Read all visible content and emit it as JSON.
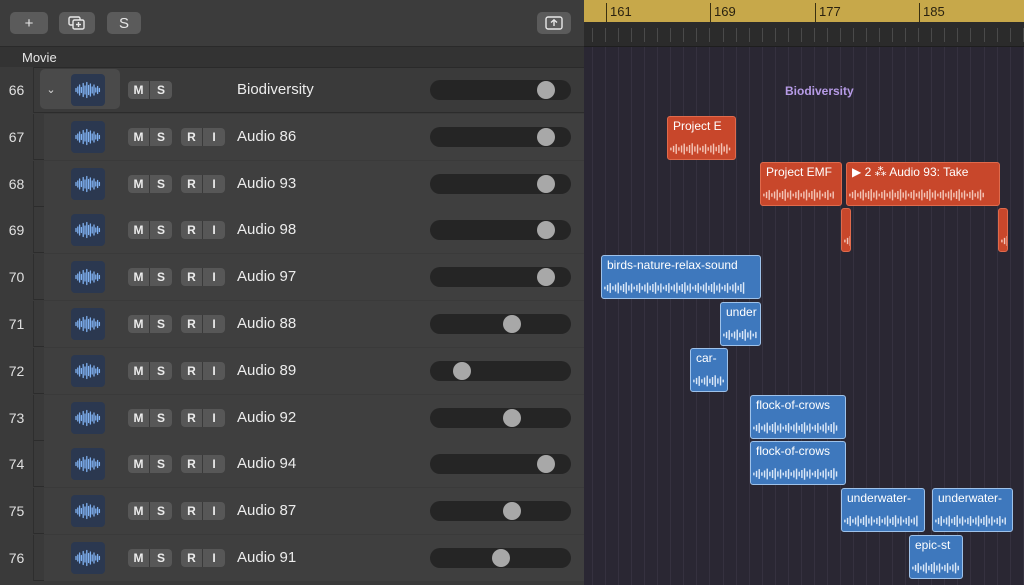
{
  "toolbar": {
    "add_label": "+",
    "duplicate_label": "⧉",
    "solo_label": "S",
    "upload_label": "⇪"
  },
  "group_label": "Movie",
  "tracks": [
    {
      "num": "66",
      "name": "Biodiversity",
      "folder": true,
      "ms": [
        "M",
        "S"
      ],
      "volume": 0.88
    },
    {
      "num": "67",
      "name": "Audio 86",
      "ms": [
        "M",
        "S",
        "R",
        "I"
      ],
      "volume": 0.88
    },
    {
      "num": "68",
      "name": "Audio 93",
      "ms": [
        "M",
        "S",
        "R",
        "I"
      ],
      "volume": 0.88
    },
    {
      "num": "69",
      "name": "Audio 98",
      "ms": [
        "M",
        "S",
        "R",
        "I"
      ],
      "volume": 0.88
    },
    {
      "num": "70",
      "name": "Audio 97",
      "ms": [
        "M",
        "S",
        "R",
        "I"
      ],
      "volume": 0.88
    },
    {
      "num": "71",
      "name": "Audio 88",
      "ms": [
        "M",
        "S",
        "R",
        "I"
      ],
      "volume": 0.6
    },
    {
      "num": "72",
      "name": "Audio 89",
      "ms": [
        "M",
        "S",
        "R",
        "I"
      ],
      "volume": 0.18
    },
    {
      "num": "73",
      "name": "Audio 92",
      "ms": [
        "M",
        "S",
        "R",
        "I"
      ],
      "volume": 0.6
    },
    {
      "num": "74",
      "name": "Audio 94",
      "ms": [
        "M",
        "S",
        "R",
        "I"
      ],
      "volume": 0.88
    },
    {
      "num": "75",
      "name": "Audio 87",
      "ms": [
        "M",
        "S",
        "R",
        "I"
      ],
      "volume": 0.6
    },
    {
      "num": "76",
      "name": "Audio 91",
      "ms": [
        "M",
        "S",
        "R",
        "I"
      ],
      "volume": 0.5
    }
  ],
  "ruler": {
    "bars": [
      "161",
      "169",
      "177",
      "185"
    ]
  },
  "folder_region_label": "Biodiversity",
  "regions": [
    {
      "label": "Project E",
      "color": "red",
      "row": 1
    },
    {
      "label": "Project EMF",
      "color": "red",
      "row": 2
    },
    {
      "label": "▶ 2 ⁂ Audio 93: Take",
      "color": "red",
      "row": 2
    },
    {
      "label": "",
      "color": "red",
      "row": 3
    },
    {
      "label": "",
      "color": "red",
      "row": 3
    },
    {
      "label": "birds-nature-relax-sound",
      "color": "blue",
      "row": 4
    },
    {
      "label": "under",
      "color": "blue",
      "row": 5
    },
    {
      "label": "car-",
      "color": "blue",
      "row": 6
    },
    {
      "label": "flock-of-crows",
      "color": "blue",
      "row": 7
    },
    {
      "label": "flock-of-crows",
      "color": "blue",
      "row": 8
    },
    {
      "label": "underwater-",
      "color": "blue",
      "row": 9
    },
    {
      "label": "underwater-",
      "color": "blue",
      "row": 9
    },
    {
      "label": "epic-st",
      "color": "blue",
      "row": 10
    }
  ],
  "colors": {
    "ruler": "#c7a84a",
    "audio_region": "#3e78bd",
    "take_region": "#c8472b",
    "folder_label": "#b69be6"
  }
}
